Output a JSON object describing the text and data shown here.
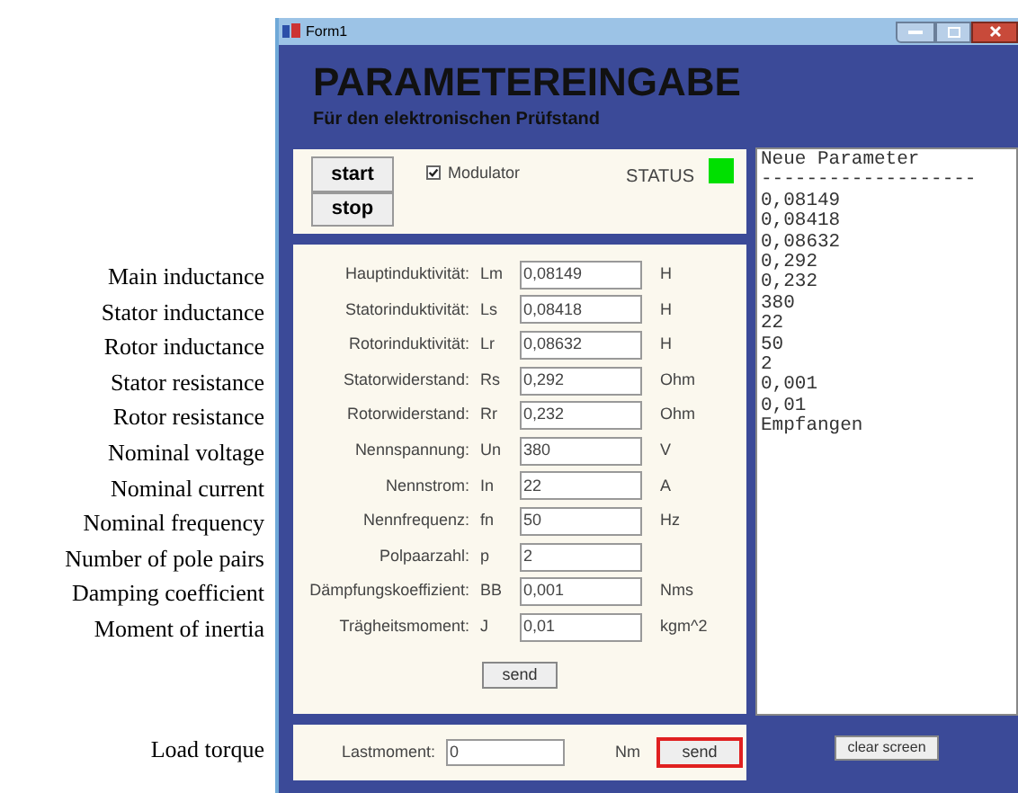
{
  "window": {
    "title": "Form1"
  },
  "heading": "PARAMETEREINGABE",
  "subheading": "Für den elektronischen Prüfstand",
  "control_panel": {
    "start_button": "start",
    "stop_button": "stop",
    "modulator": {
      "label": "Modulator",
      "checked": true
    },
    "status": {
      "label": "STATUS",
      "on": true
    }
  },
  "parameters": [
    {
      "annotation": "Main inductance",
      "label": "Hauptinduktivität:",
      "symbol": "Lm",
      "value": "0,08149",
      "unit": "H"
    },
    {
      "annotation": "Stator inductance",
      "label": "Statorinduktivität:",
      "symbol": "Ls",
      "value": "0,08418",
      "unit": "H"
    },
    {
      "annotation": "Rotor inductance",
      "label": "Rotorinduktivität:",
      "symbol": "Lr",
      "value": "0,08632",
      "unit": "H"
    },
    {
      "annotation": "Stator resistance",
      "label": "Statorwiderstand:",
      "symbol": "Rs",
      "value": "0,292",
      "unit": "Ohm"
    },
    {
      "annotation": "Rotor resistance",
      "label": "Rotorwiderstand:",
      "symbol": "Rr",
      "value": "0,232",
      "unit": "Ohm"
    },
    {
      "annotation": "Nominal voltage",
      "label": "Nennspannung:",
      "symbol": "Un",
      "value": "380",
      "unit": "V"
    },
    {
      "annotation": "Nominal current",
      "label": "Nennstrom:",
      "symbol": "In",
      "value": "22",
      "unit": "A"
    },
    {
      "annotation": "Nominal frequency",
      "label": "Nennfrequenz:",
      "symbol": "fn",
      "value": "50",
      "unit": "Hz"
    },
    {
      "annotation": "Number of pole pairs",
      "label": "Polpaarzahl:",
      "symbol": "p",
      "value": "2"
    },
    {
      "annotation": "Damping coefficient",
      "label": "Dämpfungskoeffizient:",
      "symbol": "BB",
      "value": "0,001",
      "unit": "Nms"
    },
    {
      "annotation": "Moment of inertia",
      "label": "Trägheitsmoment:",
      "symbol": "J",
      "value": "0,01",
      "unit": "kgm^2"
    }
  ],
  "parameters_send_button": "send",
  "load_torque": {
    "annotation": "Load torque",
    "label": "Lastmoment:",
    "value": "0",
    "unit": "Nm",
    "button": "send",
    "highlighted": true
  },
  "console": {
    "lines": [
      "Neue Parameter",
      "-------------------",
      "0,08149",
      "0,08418",
      "0,08632",
      "0,292",
      "0,232",
      "380",
      "22",
      "50",
      "2",
      "0,001",
      "0,01",
      "Empfangen"
    ]
  },
  "clear_button": "clear screen"
}
